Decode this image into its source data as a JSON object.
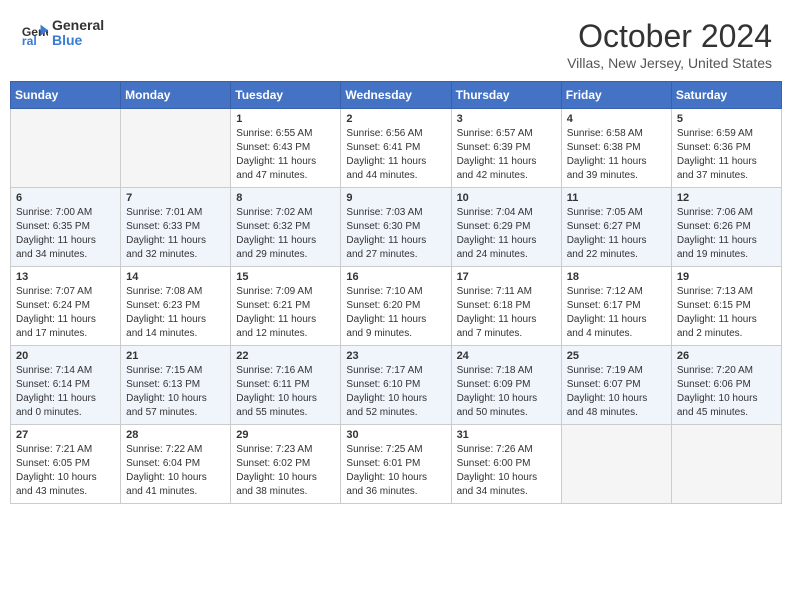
{
  "header": {
    "logo_line1": "General",
    "logo_line2": "Blue",
    "month": "October 2024",
    "location": "Villas, New Jersey, United States"
  },
  "weekdays": [
    "Sunday",
    "Monday",
    "Tuesday",
    "Wednesday",
    "Thursday",
    "Friday",
    "Saturday"
  ],
  "weeks": [
    [
      {
        "num": "",
        "info": ""
      },
      {
        "num": "",
        "info": ""
      },
      {
        "num": "1",
        "info": "Sunrise: 6:55 AM\nSunset: 6:43 PM\nDaylight: 11 hours and 47 minutes."
      },
      {
        "num": "2",
        "info": "Sunrise: 6:56 AM\nSunset: 6:41 PM\nDaylight: 11 hours and 44 minutes."
      },
      {
        "num": "3",
        "info": "Sunrise: 6:57 AM\nSunset: 6:39 PM\nDaylight: 11 hours and 42 minutes."
      },
      {
        "num": "4",
        "info": "Sunrise: 6:58 AM\nSunset: 6:38 PM\nDaylight: 11 hours and 39 minutes."
      },
      {
        "num": "5",
        "info": "Sunrise: 6:59 AM\nSunset: 6:36 PM\nDaylight: 11 hours and 37 minutes."
      }
    ],
    [
      {
        "num": "6",
        "info": "Sunrise: 7:00 AM\nSunset: 6:35 PM\nDaylight: 11 hours and 34 minutes."
      },
      {
        "num": "7",
        "info": "Sunrise: 7:01 AM\nSunset: 6:33 PM\nDaylight: 11 hours and 32 minutes."
      },
      {
        "num": "8",
        "info": "Sunrise: 7:02 AM\nSunset: 6:32 PM\nDaylight: 11 hours and 29 minutes."
      },
      {
        "num": "9",
        "info": "Sunrise: 7:03 AM\nSunset: 6:30 PM\nDaylight: 11 hours and 27 minutes."
      },
      {
        "num": "10",
        "info": "Sunrise: 7:04 AM\nSunset: 6:29 PM\nDaylight: 11 hours and 24 minutes."
      },
      {
        "num": "11",
        "info": "Sunrise: 7:05 AM\nSunset: 6:27 PM\nDaylight: 11 hours and 22 minutes."
      },
      {
        "num": "12",
        "info": "Sunrise: 7:06 AM\nSunset: 6:26 PM\nDaylight: 11 hours and 19 minutes."
      }
    ],
    [
      {
        "num": "13",
        "info": "Sunrise: 7:07 AM\nSunset: 6:24 PM\nDaylight: 11 hours and 17 minutes."
      },
      {
        "num": "14",
        "info": "Sunrise: 7:08 AM\nSunset: 6:23 PM\nDaylight: 11 hours and 14 minutes."
      },
      {
        "num": "15",
        "info": "Sunrise: 7:09 AM\nSunset: 6:21 PM\nDaylight: 11 hours and 12 minutes."
      },
      {
        "num": "16",
        "info": "Sunrise: 7:10 AM\nSunset: 6:20 PM\nDaylight: 11 hours and 9 minutes."
      },
      {
        "num": "17",
        "info": "Sunrise: 7:11 AM\nSunset: 6:18 PM\nDaylight: 11 hours and 7 minutes."
      },
      {
        "num": "18",
        "info": "Sunrise: 7:12 AM\nSunset: 6:17 PM\nDaylight: 11 hours and 4 minutes."
      },
      {
        "num": "19",
        "info": "Sunrise: 7:13 AM\nSunset: 6:15 PM\nDaylight: 11 hours and 2 minutes."
      }
    ],
    [
      {
        "num": "20",
        "info": "Sunrise: 7:14 AM\nSunset: 6:14 PM\nDaylight: 11 hours and 0 minutes."
      },
      {
        "num": "21",
        "info": "Sunrise: 7:15 AM\nSunset: 6:13 PM\nDaylight: 10 hours and 57 minutes."
      },
      {
        "num": "22",
        "info": "Sunrise: 7:16 AM\nSunset: 6:11 PM\nDaylight: 10 hours and 55 minutes."
      },
      {
        "num": "23",
        "info": "Sunrise: 7:17 AM\nSunset: 6:10 PM\nDaylight: 10 hours and 52 minutes."
      },
      {
        "num": "24",
        "info": "Sunrise: 7:18 AM\nSunset: 6:09 PM\nDaylight: 10 hours and 50 minutes."
      },
      {
        "num": "25",
        "info": "Sunrise: 7:19 AM\nSunset: 6:07 PM\nDaylight: 10 hours and 48 minutes."
      },
      {
        "num": "26",
        "info": "Sunrise: 7:20 AM\nSunset: 6:06 PM\nDaylight: 10 hours and 45 minutes."
      }
    ],
    [
      {
        "num": "27",
        "info": "Sunrise: 7:21 AM\nSunset: 6:05 PM\nDaylight: 10 hours and 43 minutes."
      },
      {
        "num": "28",
        "info": "Sunrise: 7:22 AM\nSunset: 6:04 PM\nDaylight: 10 hours and 41 minutes."
      },
      {
        "num": "29",
        "info": "Sunrise: 7:23 AM\nSunset: 6:02 PM\nDaylight: 10 hours and 38 minutes."
      },
      {
        "num": "30",
        "info": "Sunrise: 7:25 AM\nSunset: 6:01 PM\nDaylight: 10 hours and 36 minutes."
      },
      {
        "num": "31",
        "info": "Sunrise: 7:26 AM\nSunset: 6:00 PM\nDaylight: 10 hours and 34 minutes."
      },
      {
        "num": "",
        "info": ""
      },
      {
        "num": "",
        "info": ""
      }
    ]
  ]
}
